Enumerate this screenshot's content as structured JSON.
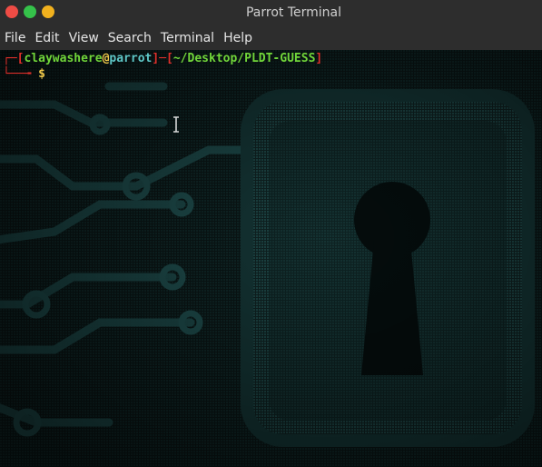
{
  "window": {
    "title": "Parrot Terminal",
    "controls": [
      {
        "name": "close",
        "color": "#ef4c45"
      },
      {
        "name": "maximize",
        "color": "#35c24a"
      },
      {
        "name": "minimize",
        "color": "#f1b11e"
      }
    ]
  },
  "menu": {
    "items": [
      "File",
      "Edit",
      "View",
      "Search",
      "Terminal",
      "Help"
    ]
  },
  "terminal": {
    "prompt": {
      "corner_top": "┌─",
      "open_bracket": "[",
      "user": "claywashere",
      "at": "@",
      "host": "parrot",
      "close_bracket": "]",
      "separator": "─",
      "path_open": "[",
      "path": "~/Desktop/PLDT-GUESS",
      "path_close": "]",
      "corner_bottom": "└──╼",
      "dollar": "$"
    },
    "colors": {
      "bracket": "#e0302b",
      "user": "#71d63a",
      "at": "#f0c84a",
      "host": "#5ec6c6",
      "path": "#71d63a",
      "dollar": "#f0c84a"
    },
    "background_icon": "padlock-keyhole-circuit-wallpaper"
  }
}
